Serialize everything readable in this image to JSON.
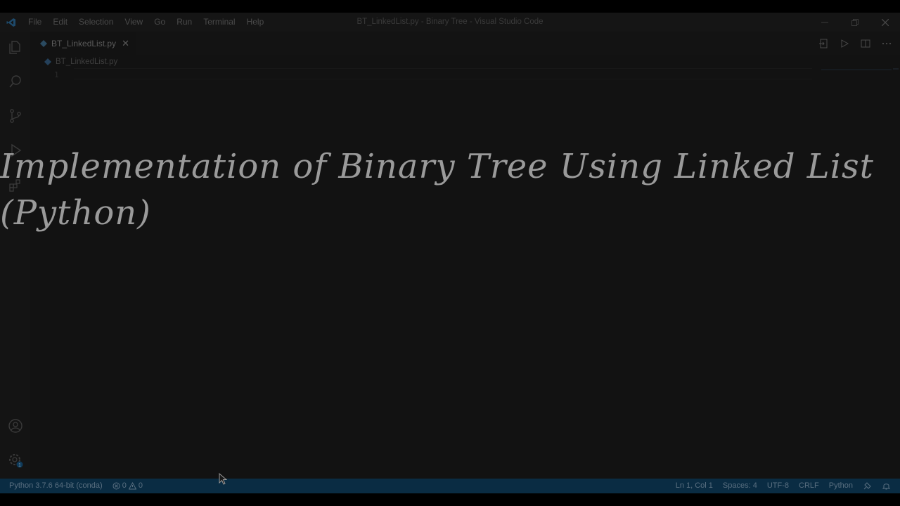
{
  "window": {
    "title": "BT_LinkedList.py - Binary Tree - Visual Studio Code"
  },
  "menu": [
    "File",
    "Edit",
    "Selection",
    "View",
    "Go",
    "Run",
    "Terminal",
    "Help"
  ],
  "tab": {
    "label": "BT_LinkedList.py",
    "close_glyph": "✕"
  },
  "breadcrumb": {
    "file": "BT_LinkedList.py"
  },
  "editor": {
    "line_number": "1"
  },
  "overlay": {
    "line1": "Implementation of Binary Tree Using Linked List",
    "line2": "(Python)"
  },
  "activity_bar": {
    "items": [
      "files-icon",
      "search-icon",
      "source-control-icon",
      "run-debug-icon",
      "extensions-icon"
    ],
    "bottom": [
      "account-icon",
      "manage-gear-icon"
    ],
    "settings_badge": "1"
  },
  "statusbar": {
    "interpreter": "Python 3.7.6 64-bit (conda)",
    "errors": "0",
    "warnings": "0",
    "position": "Ln 1, Col 1",
    "spaces": "Spaces: 4",
    "encoding": "UTF-8",
    "eol": "CRLF",
    "language": "Python"
  },
  "colors": {
    "statusbar": "#0a2c43",
    "background": "#121212",
    "headline": "#9a9a9a"
  }
}
